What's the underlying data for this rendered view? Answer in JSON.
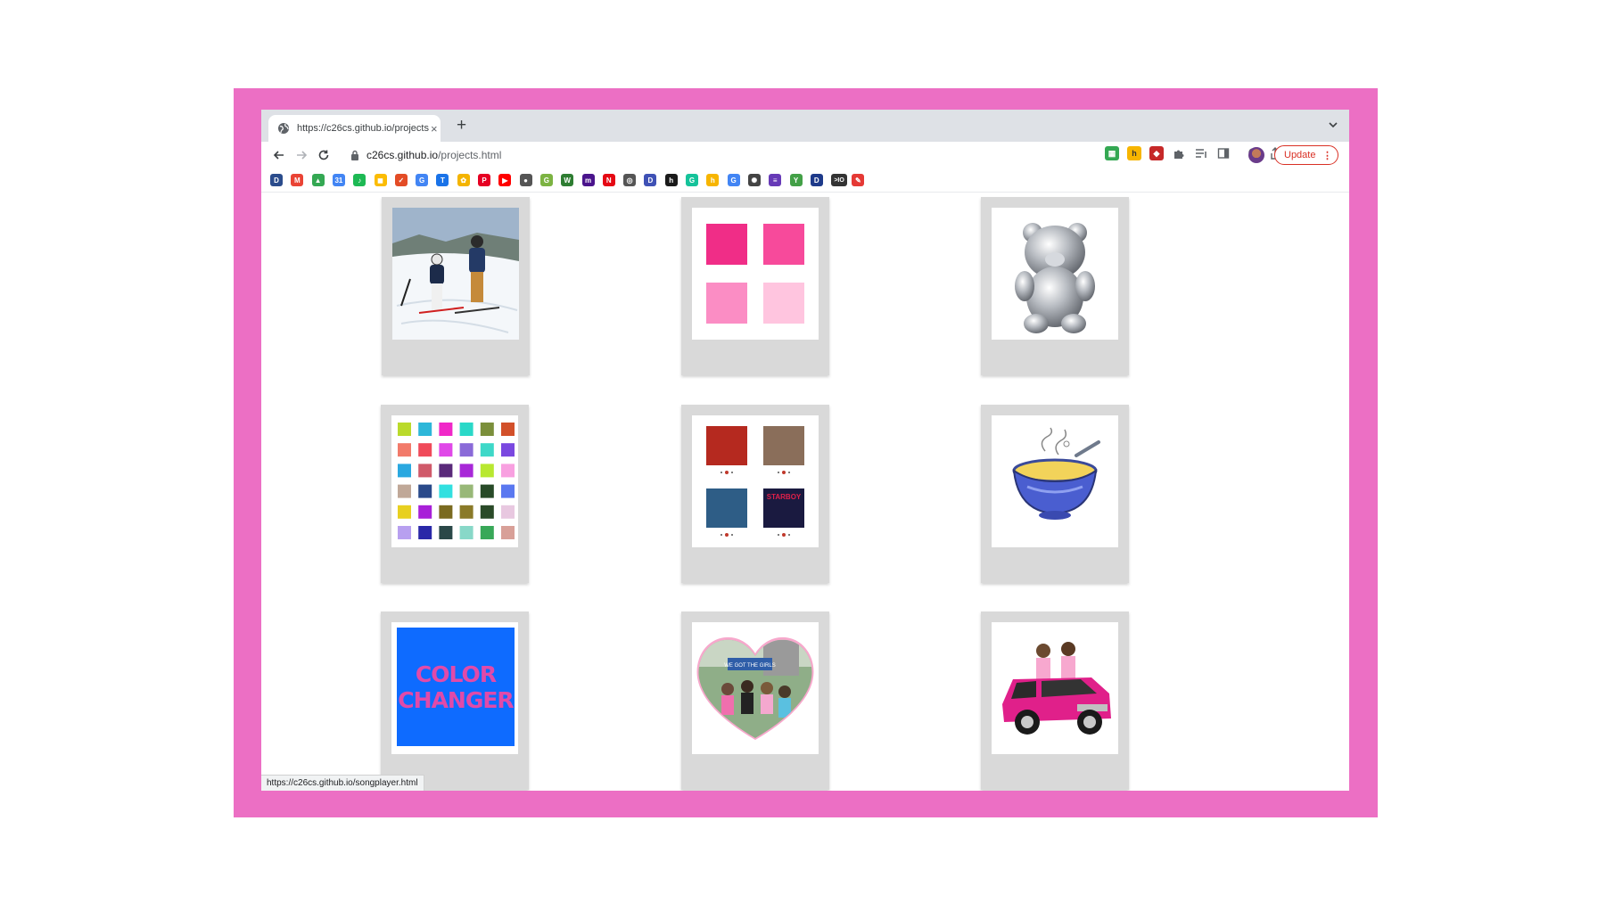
{
  "browser": {
    "tab": {
      "title": "https://c26cs.github.io/projects",
      "close_glyph": "×"
    },
    "new_tab_glyph": "+",
    "address": {
      "host": "c26cs.github.io",
      "path": "/projects.html"
    },
    "update_label": "Update",
    "update_menu_glyph": "⋮",
    "status_url": "https://c26cs.github.io/songplayer.html",
    "accent_color": "#d93025",
    "frame_color": "#ec6fc4"
  },
  "bookmarks": [
    {
      "icon": "d-icon",
      "letter": "D",
      "color": "#2b4c8c"
    },
    {
      "icon": "gmail-icon",
      "letter": "M",
      "color": "#ea4335"
    },
    {
      "icon": "drive-icon",
      "letter": "▲",
      "color": "#34a853"
    },
    {
      "icon": "calendar-icon",
      "letter": "31",
      "color": "#4285f4"
    },
    {
      "icon": "spotify-icon",
      "letter": "♪",
      "color": "#1db954"
    },
    {
      "icon": "keep-icon",
      "letter": "◼",
      "color": "#fbbc04"
    },
    {
      "icon": "todo-icon",
      "letter": "✓",
      "color": "#e34c26"
    },
    {
      "icon": "translate-icon",
      "letter": "G",
      "color": "#4285f4"
    },
    {
      "icon": "t-icon",
      "letter": "T",
      "color": "#1a73e8"
    },
    {
      "icon": "photos-icon",
      "letter": "✿",
      "color": "#f4b400"
    },
    {
      "icon": "pinterest-icon",
      "letter": "P",
      "color": "#e60023"
    },
    {
      "icon": "youtube-icon",
      "letter": "▶",
      "color": "#ff0000"
    },
    {
      "icon": "apple-icon",
      "letter": "●",
      "color": "#555555"
    },
    {
      "icon": "grades-icon",
      "letter": "G",
      "color": "#7cb342"
    },
    {
      "icon": "w-icon",
      "letter": "W",
      "color": "#2e7d32"
    },
    {
      "icon": "m-icon",
      "letter": "m",
      "color": "#4a148c"
    },
    {
      "icon": "netflix-icon",
      "letter": "N",
      "color": "#e50914"
    },
    {
      "icon": "globe-icon",
      "letter": "◎",
      "color": "#555555"
    },
    {
      "icon": "d-icon",
      "letter": "D",
      "color": "#3f51b5"
    },
    {
      "icon": "h-icon",
      "letter": "h",
      "color": "#1a1a1a"
    },
    {
      "icon": "grammarly-icon",
      "letter": "G",
      "color": "#15c39a"
    },
    {
      "icon": "honey-icon",
      "letter": "h",
      "color": "#f7b500"
    },
    {
      "icon": "google-icon",
      "letter": "G",
      "color": "#4285f4"
    },
    {
      "icon": "openai-icon",
      "letter": "✺",
      "color": "#444444"
    },
    {
      "icon": "forms-icon",
      "letter": "≡",
      "color": "#673ab7"
    },
    {
      "icon": "y-icon",
      "letter": "Y",
      "color": "#43a047"
    },
    {
      "icon": "disney-icon",
      "letter": "D",
      "color": "#1e3a8a"
    },
    {
      "icon": "io-icon",
      "letter": ">IO",
      "color": "#333333"
    },
    {
      "icon": "brush-icon",
      "letter": "✎",
      "color": "#e53935"
    }
  ],
  "projects": [
    {
      "name": "project-ski-photo"
    },
    {
      "name": "project-pink-squares",
      "colors": [
        "#f02d87",
        "#f74a9b",
        "#fb8dc4",
        "#ffc5df"
      ]
    },
    {
      "name": "project-chrome-bear"
    },
    {
      "name": "project-color-palette",
      "colors": [
        "#bada2b",
        "#2db7d9",
        "#f028c8",
        "#2ad8c8",
        "#7b8f3b",
        "#d2502a",
        "#f27a6a",
        "#f04a5a",
        "#e048e8",
        "#8a6ad8",
        "#3ed8c8",
        "#7a48e0",
        "#2aa8e0",
        "#d05a6a",
        "#5a2a7a",
        "#a828d8",
        "#b8e830",
        "#f8a0e0",
        "#c0a898",
        "#2a4a8a",
        "#32e0e0",
        "#98b878",
        "#284a28",
        "#5a78f0",
        "#e8d020",
        "#a820d8",
        "#7a6a20",
        "#8a7a28",
        "#2a4a28",
        "#e8c8e0",
        "#b8a0f0",
        "#2a28a8",
        "#2a4848",
        "#88d8c8",
        "#38a858",
        "#d8a098"
      ]
    },
    {
      "name": "project-song-player",
      "albums": [
        {
          "bg": "#b5291f",
          "label": ""
        },
        {
          "bg": "#8a6e5a",
          "label": ""
        },
        {
          "bg": "#2e5d86",
          "label": ""
        },
        {
          "bg": "#1a1a40",
          "label": "STARBOY"
        }
      ]
    },
    {
      "name": "project-soup-bowl"
    },
    {
      "name": "project-color-changer",
      "line1": "COLOR",
      "line2": "CHANGER",
      "bg": "#0e6bff",
      "text_color": "#e14aa9"
    },
    {
      "name": "project-heart-collage",
      "sign": "WE GOT THE GIRLS"
    },
    {
      "name": "project-pink-car"
    }
  ]
}
